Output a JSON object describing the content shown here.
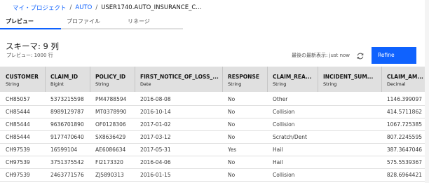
{
  "breadcrumb": {
    "project": "マイ・プロジェクト",
    "separator": "/",
    "folder": "AUTO",
    "current": "USER1740.AUTO_INSURANCE_C..."
  },
  "tabs": [
    {
      "label": "プレビュー",
      "active": true
    },
    {
      "label": "プロファイル",
      "active": false
    },
    {
      "label": "リネージ",
      "active": false
    }
  ],
  "summary": {
    "schema_title": "スキーマ: 9 列",
    "preview_rows": "プレビュー: 1000 行",
    "refresh_label": "最後の最新表示: just now",
    "refine_label": "Refine",
    "refresh_icon": "refresh-icon",
    "accent_color": "#0f62fe"
  },
  "columns": [
    {
      "name": "CUSTOMER",
      "type": "String"
    },
    {
      "name": "CLAIM_ID",
      "type": "Bigint"
    },
    {
      "name": "POLICY_ID",
      "type": "String"
    },
    {
      "name": "FIRST_NOTICE_OF_LOSS_...",
      "type": "Date"
    },
    {
      "name": "RESPONSE",
      "type": "String"
    },
    {
      "name": "CLAIM_REA...",
      "type": "String"
    },
    {
      "name": "INCIDENT_SUM...",
      "type": "String"
    },
    {
      "name": "CLAIM_AM...",
      "type": "Decimal"
    }
  ],
  "rows": [
    [
      "CH85057",
      "5373215598",
      "PM4788594",
      "2016-08-08",
      "No",
      "Other",
      "",
      "1146.399097"
    ],
    [
      "CH85444",
      "8989129787",
      "MT0378990",
      "2016-10-14",
      "No",
      "Collision",
      "",
      "414.5711862"
    ],
    [
      "CH85444",
      "9636701890",
      "OF0128306",
      "2017-01-02",
      "No",
      "Collision",
      "",
      "1067.725385"
    ],
    [
      "CH85444",
      "9177470640",
      "SX8636429",
      "2017-03-12",
      "No",
      "Scratch/Dent",
      "",
      "807.2245595"
    ],
    [
      "CH97539",
      "16599104",
      "AE6086634",
      "2017-05-31",
      "Yes",
      "Hail",
      "",
      "387.3647046"
    ],
    [
      "CH97539",
      "3751375542",
      "FI2173320",
      "2016-04-06",
      "No",
      "Hail",
      "",
      "575.5539367"
    ],
    [
      "CH97539",
      "2463771576",
      "ZJ5890313",
      "2016-01-15",
      "No",
      "Collision",
      "",
      "828.6964421"
    ]
  ]
}
